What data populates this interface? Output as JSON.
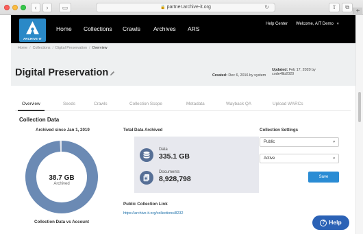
{
  "browser": {
    "back_glyph": "‹",
    "forward_glyph": "›",
    "sidebar_glyph": "▭",
    "url": "partner.archive-it.org",
    "share_glyph": "⇧",
    "tabs_glyph": "⧉",
    "new_tab_glyph": "+"
  },
  "header": {
    "logo_text": "ARCHIVE-IT",
    "nav": [
      "Home",
      "Collections",
      "Crawls",
      "Archives",
      "ARS"
    ],
    "help_center": "Help Center",
    "welcome": "Welcome, AIT Demo",
    "accent_color": "#2a89c7"
  },
  "breadcrumb": [
    "Home",
    "Collections",
    "Digital Preservation",
    "Overview"
  ],
  "page": {
    "title": "Digital Preservation",
    "created_label": "Created:",
    "created_value": "Dec 6, 2016 by system",
    "updated_label": "Updated:",
    "updated_value": "Feb 17, 2020 by",
    "updated_by": "code4lib2020"
  },
  "tabs": [
    "Overview",
    "Seeds",
    "Crawls",
    "Collection Scope",
    "Metadata",
    "Wayback QA",
    "Upload WARCs"
  ],
  "collection_data": {
    "section_title": "Collection Data",
    "archived_since": "Archived since Jan 1, 2019",
    "donut_value": "38.7 GB",
    "donut_label": "Archived",
    "donut_fraction": 0.99,
    "donut_color": "#6b8ab4",
    "caption": "Collection Data vs Account"
  },
  "total": {
    "title": "Total Data Archived",
    "data_label": "Data",
    "data_value": "335.1 GB",
    "documents_label": "Documents",
    "documents_value": "8,928,798",
    "icon_data": "database-icon",
    "icon_documents": "documents-icon"
  },
  "public_link": {
    "title": "Public Collection Link",
    "url": "https://archive-it.org/collections/8232"
  },
  "settings": {
    "title": "Collection Settings",
    "visibility": "Public",
    "status": "Active",
    "save_label": "Save"
  },
  "help": {
    "label": "Help",
    "glyph": "?"
  }
}
